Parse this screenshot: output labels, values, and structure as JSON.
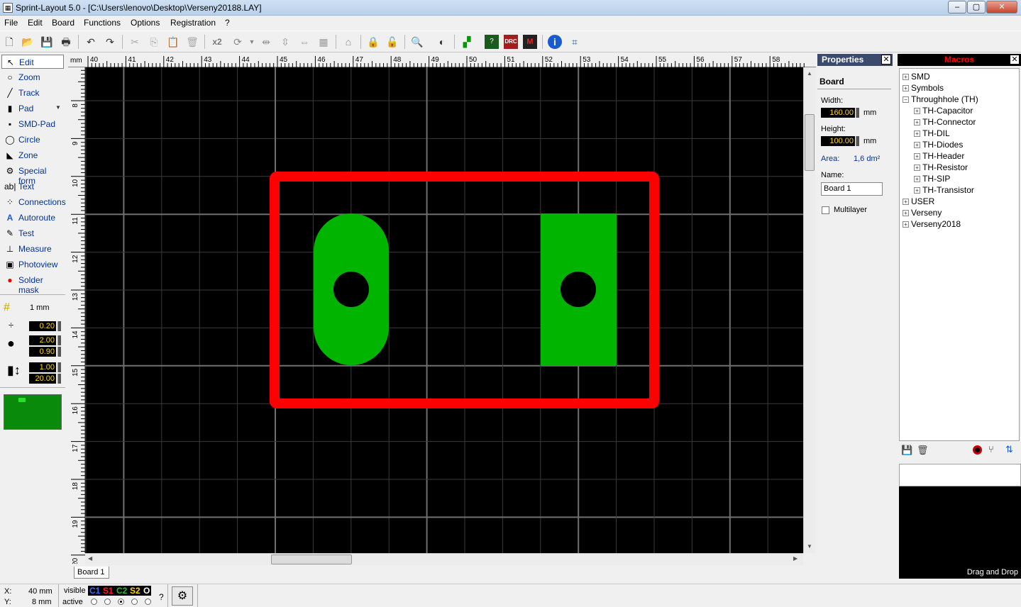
{
  "window": {
    "title": "Sprint-Layout 5.0 - [C:\\Users\\lenovo\\Desktop\\Verseny20188.LAY]",
    "app_icon": "pcb-app-icon"
  },
  "menu": [
    "File",
    "Edit",
    "Board",
    "Functions",
    "Options",
    "Registration",
    "?"
  ],
  "toolbar": {
    "zoom_label": "x2"
  },
  "tools": [
    {
      "label": "Edit",
      "icon": "cursor-icon",
      "glyph": "↖",
      "active": true
    },
    {
      "label": "Zoom",
      "icon": "magnifier-icon",
      "glyph": "○"
    },
    {
      "label": "Track",
      "icon": "track-icon",
      "glyph": "╱"
    },
    {
      "label": "Pad",
      "icon": "pad-icon",
      "glyph": "▮"
    },
    {
      "label": "SMD-Pad",
      "icon": "smd-pad-icon",
      "glyph": "▪"
    },
    {
      "label": "Circle",
      "icon": "circle-icon",
      "glyph": "◯"
    },
    {
      "label": "Zone",
      "icon": "zone-icon",
      "glyph": "◣"
    },
    {
      "label": "Special form",
      "icon": "special-form-icon",
      "glyph": "⚙"
    },
    {
      "label": "Text",
      "icon": "text-icon",
      "glyph": "ab|"
    },
    {
      "label": "Connections",
      "icon": "connections-icon",
      "glyph": "⁘"
    },
    {
      "label": "Autoroute",
      "icon": "autoroute-icon",
      "glyph": "A"
    },
    {
      "label": "Test",
      "icon": "test-icon",
      "glyph": "✎"
    },
    {
      "label": "Measure",
      "icon": "measure-icon",
      "glyph": "⊥"
    },
    {
      "label": "Photoview",
      "icon": "photoview-icon",
      "glyph": "▣"
    },
    {
      "label": "Solder mask",
      "icon": "solder-mask-icon",
      "glyph": "●"
    }
  ],
  "settings": {
    "grid": "1 mm",
    "track_width": "0.20",
    "pad_outer": "2.00",
    "pad_inner": "0.90",
    "smd_width": "1.00",
    "smd_height": "20.00"
  },
  "board": {
    "outline_color": "#ff0000",
    "copper_color": "#00b400",
    "background": "#000000",
    "tab_label": "Board 1"
  },
  "ruler": {
    "unit": "mm",
    "x_labels": [
      "40",
      "41",
      "42",
      "43",
      "44",
      "45",
      "46",
      "47",
      "48",
      "49",
      "50",
      "51",
      "52",
      "53",
      "54",
      "55",
      "56",
      "57",
      "58"
    ],
    "y_labels": [
      "8",
      "9",
      "10",
      "11",
      "12",
      "13",
      "14",
      "15",
      "16",
      "17",
      "18",
      "19",
      "20"
    ]
  },
  "properties": {
    "header": "Properties",
    "section": "Board",
    "width_label": "Width:",
    "width_value": "160.00",
    "height_label": "Height:",
    "height_value": "100.00",
    "unit": "mm",
    "area_label": "Area:",
    "area_value": "1,6 dm²",
    "name_label": "Name:",
    "name_value": "Board 1",
    "multilayer_label": "Multilayer",
    "multilayer_checked": false
  },
  "macros": {
    "header": "Macros",
    "header_color": "#ff0000",
    "tree": [
      {
        "label": "SMD",
        "level": 0,
        "expanded": false
      },
      {
        "label": "Symbols",
        "level": 0,
        "expanded": false
      },
      {
        "label": "Throughhole (TH)",
        "level": 0,
        "expanded": true
      },
      {
        "label": "TH-Capacitor",
        "level": 1,
        "expanded": false
      },
      {
        "label": "TH-Connector",
        "level": 1,
        "expanded": false
      },
      {
        "label": "TH-DIL",
        "level": 1,
        "expanded": false
      },
      {
        "label": "TH-Diodes",
        "level": 1,
        "expanded": false
      },
      {
        "label": "TH-Header",
        "level": 1,
        "expanded": false
      },
      {
        "label": "TH-Resistor",
        "level": 1,
        "expanded": false
      },
      {
        "label": "TH-SIP",
        "level": 1,
        "expanded": false
      },
      {
        "label": "TH-Transistor",
        "level": 1,
        "expanded": false
      },
      {
        "label": "USER",
        "level": 0,
        "expanded": false
      },
      {
        "label": "Verseny",
        "level": 0,
        "expanded": false
      },
      {
        "label": "Verseny2018",
        "level": 0,
        "expanded": false
      }
    ],
    "drag_drop": "Drag and Drop"
  },
  "status": {
    "x_label": "X:",
    "x_value": "40 mm",
    "y_label": "Y:",
    "y_value": "8 mm",
    "visible_label": "visible",
    "active_label": "active",
    "layers": [
      {
        "name": "C1",
        "color": "#3b6cff"
      },
      {
        "name": "S1",
        "color": "#ff2020"
      },
      {
        "name": "C2",
        "color": "#20c020"
      },
      {
        "name": "S2",
        "color": "#ffd800"
      },
      {
        "name": "O",
        "color": "#ffffff"
      }
    ],
    "active_layer_index": 2,
    "help": "?"
  }
}
